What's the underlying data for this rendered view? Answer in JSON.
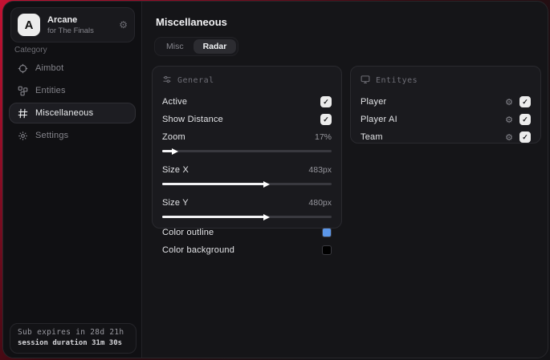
{
  "app": {
    "initial": "A",
    "title": "Arcane",
    "subtitle": "for The Finals"
  },
  "sidebar": {
    "category_label": "Category",
    "items": [
      {
        "label": "Aimbot",
        "icon": "crosshair-icon",
        "selected": false
      },
      {
        "label": "Entities",
        "icon": "nodes-icon",
        "selected": false
      },
      {
        "label": "Miscellaneous",
        "icon": "grid-icon",
        "selected": true
      },
      {
        "label": "Settings",
        "icon": "gear-icon",
        "selected": false
      }
    ],
    "footer": {
      "line1": "Sub expires in 28d 21h",
      "line2": "session duration 31m 30s"
    }
  },
  "main": {
    "title": "Miscellaneous",
    "tabs": [
      {
        "label": "Misc",
        "active": false
      },
      {
        "label": "Radar",
        "active": true
      }
    ]
  },
  "general_panel": {
    "title": "General",
    "toggles": [
      {
        "label": "Active",
        "checked": true
      },
      {
        "label": "Show Distance",
        "checked": true
      }
    ],
    "sliders": [
      {
        "label": "Zoom",
        "value": "17%",
        "fill": "6%"
      },
      {
        "label": "Size X",
        "value": "483px",
        "fill": "60%"
      },
      {
        "label": "Size Y",
        "value": "480px",
        "fill": "60%"
      }
    ],
    "colors": [
      {
        "label": "Color outline",
        "color": "#5b96e8"
      },
      {
        "label": "Color background",
        "color": "#000000"
      }
    ]
  },
  "entities_panel": {
    "title": "Entityes",
    "rows": [
      {
        "label": "Player",
        "checked": true
      },
      {
        "label": "Player AI",
        "checked": true
      },
      {
        "label": "Team",
        "checked": true
      }
    ]
  },
  "icons": {
    "check_glyph": "✓",
    "gear_glyph": "⚙"
  },
  "colors": {
    "accent_blue": "#5b96e8",
    "bg_red": "#c41233",
    "panel": "#1a1a1e"
  }
}
